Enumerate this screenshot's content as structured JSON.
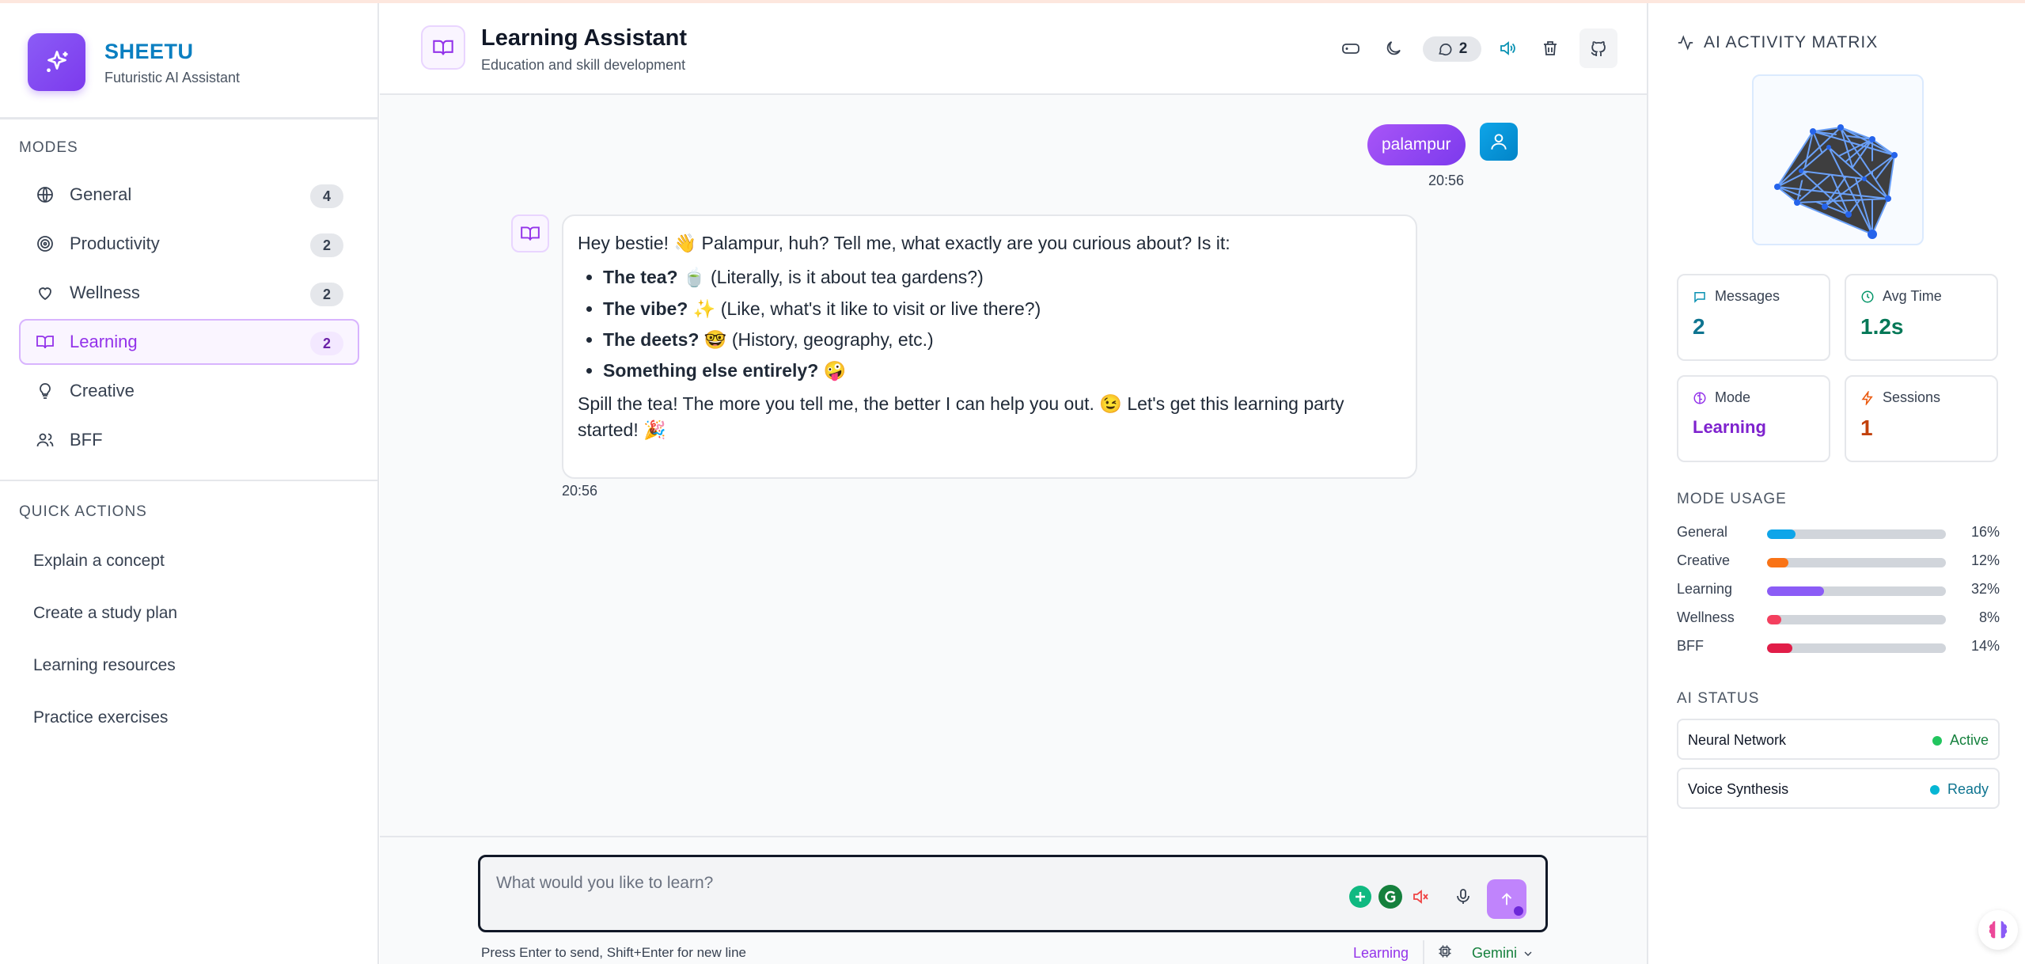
{
  "brand": {
    "name": "SHEETU",
    "subtitle": "Futuristic AI Assistant"
  },
  "sidebar": {
    "modes_title": "MODES",
    "modes": [
      {
        "label": "General",
        "count": "4",
        "icon": "globe-icon"
      },
      {
        "label": "Productivity",
        "count": "2",
        "icon": "target-icon"
      },
      {
        "label": "Wellness",
        "count": "2",
        "icon": "heart-icon"
      },
      {
        "label": "Learning",
        "count": "2",
        "icon": "book-icon",
        "active": true
      },
      {
        "label": "Creative",
        "count": "",
        "icon": "lightbulb-icon"
      },
      {
        "label": "BFF",
        "count": "",
        "icon": "users-icon"
      }
    ],
    "quick_actions_title": "QUICK ACTIONS",
    "quick_actions": [
      "Explain a concept",
      "Create a study plan",
      "Learning resources",
      "Practice exercises"
    ]
  },
  "header": {
    "title": "Learning Assistant",
    "subtitle": "Education and skill development",
    "message_count": "2"
  },
  "chat": {
    "user_message": "palampur",
    "user_time": "20:56",
    "bot_intro": "Hey bestie! 👋 Palampur, huh? Tell me, what exactly are you curious about? Is it:",
    "bot_points": [
      {
        "bold": "The tea?",
        "rest": " 🍵 (Literally, is it about tea gardens?)"
      },
      {
        "bold": "The vibe?",
        "rest": " ✨ (Like, what's it like to visit or live there?)"
      },
      {
        "bold": "The deets?",
        "rest": " 🤓 (History, geography, etc.)"
      },
      {
        "bold": "Something else entirely?",
        "rest": " 🤪"
      }
    ],
    "bot_outro": "Spill the tea! The more you tell me, the better I can help you out. 😉 Let's get this learning party started! 🎉",
    "bot_time": "20:56"
  },
  "composer": {
    "placeholder": "What would you like to learn?",
    "hint": "Press Enter to send, Shift+Enter for new line",
    "mode_label": "Learning",
    "model": "Gemini"
  },
  "right_panel": {
    "title": "AI ACTIVITY MATRIX",
    "stats": [
      {
        "label": "Messages",
        "value": "2",
        "color": "#0e7490"
      },
      {
        "label": "Avg Time",
        "value": "1.2s",
        "color": "#047857"
      },
      {
        "label": "Mode",
        "value": "Learning",
        "color": "#7e22ce"
      },
      {
        "label": "Sessions",
        "value": "1",
        "color": "#c2410c"
      }
    ],
    "usage_title": "MODE USAGE",
    "usage": [
      {
        "name": "General",
        "pct": "16%",
        "value": 0.16,
        "color": "#0ea5e9"
      },
      {
        "name": "Creative",
        "pct": "12%",
        "value": 0.12,
        "color": "#f97316"
      },
      {
        "name": "Learning",
        "pct": "32%",
        "value": 0.32,
        "color": "#8b5cf6"
      },
      {
        "name": "Wellness",
        "pct": "8%",
        "value": 0.08,
        "color": "#f43f5e"
      },
      {
        "name": "BFF",
        "pct": "14%",
        "value": 0.14,
        "color": "#e11d48"
      }
    ],
    "status_title": "AI STATUS",
    "statuses": [
      {
        "name": "Neural Network",
        "value": "Active",
        "color": "#15803d",
        "dot": "#22c55e"
      },
      {
        "name": "Voice Synthesis",
        "value": "Ready",
        "color": "#0e7490",
        "dot": "#06b6d4"
      }
    ]
  }
}
